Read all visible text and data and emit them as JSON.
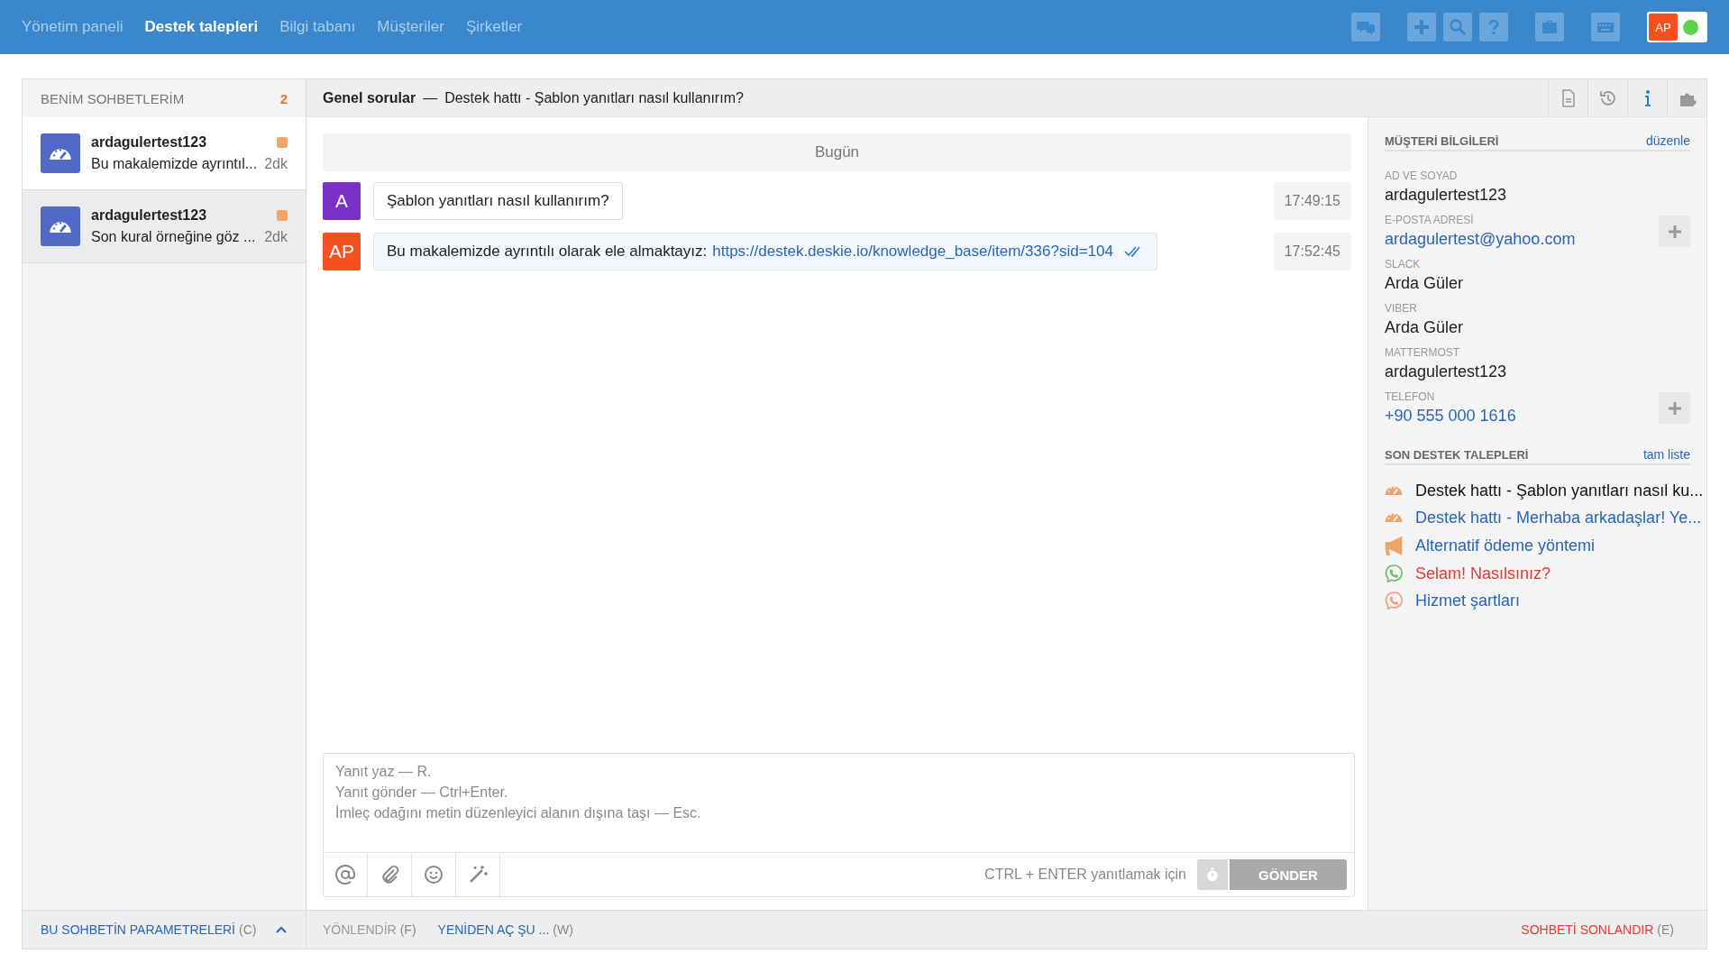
{
  "nav": {
    "tabs": [
      {
        "label": "Yönetim paneli",
        "selected": false
      },
      {
        "label": "Destek talepleri",
        "selected": true
      },
      {
        "label": "Bilgi tabanı",
        "selected": false
      },
      {
        "label": "Müşteriler",
        "selected": false
      },
      {
        "label": "Şirketler",
        "selected": false
      }
    ],
    "user": {
      "initials": "AP",
      "online": true
    }
  },
  "chat_list": {
    "title": "BENİM SOHBETLERİM",
    "count": "2",
    "items": [
      {
        "name": "ardagulertest123",
        "preview": "Bu makalemizde ayrıntıl...",
        "time": "2dk",
        "unread": true,
        "selected": true
      },
      {
        "name": "ardagulertest123",
        "preview": "Son kural örneğine göz ...",
        "time": "2dk",
        "unread": true,
        "selected": false
      }
    ]
  },
  "conversation": {
    "category": "Genel sorular",
    "separator": "—",
    "subject": "Destek hattı - Şablon yanıtları nasıl kullanırım?",
    "day": "Bugün",
    "messages": [
      {
        "kind": "incoming",
        "avatar": "A",
        "color": "#7b31c5",
        "text": "Şablon yanıtları nasıl kullanırım?",
        "time": "17:49:15",
        "read": false
      },
      {
        "kind": "outgoing",
        "avatar": "AP",
        "color": "#f4511e",
        "text": "Bu makalemizde ayrıntılı olarak ele almaktayız:",
        "link": "https://destek.deskie.io/knowledge_base/item/336?sid=104",
        "time": "17:52:45",
        "read": true
      }
    ],
    "composer": {
      "placeholder": "Yanıt yaz — R.\nYanıt gönder — Ctrl+Enter.\nİmleç odağını metin düzenleyici alanın dışına taşı — Esc.",
      "hint": "CTRL + ENTER yanıtlamak için",
      "send": "GÖNDER",
      "send_disabled": true
    }
  },
  "customer": {
    "title": "MÜŞTERİ BİLGİLERİ",
    "edit": "düzenle",
    "fields": [
      {
        "label": "AD VE SOYAD",
        "value": "ardagulertest123",
        "link": false,
        "addable": false
      },
      {
        "label": "E-POSTA ADRESİ",
        "value": "ardagulertest@yahoo.com",
        "link": true,
        "addable": true
      },
      {
        "label": "SLACK",
        "value": "Arda Güler",
        "link": false,
        "addable": false
      },
      {
        "label": "VIBER",
        "value": "Arda Güler",
        "link": false,
        "addable": false
      },
      {
        "label": "MATTERMOST",
        "value": "ardagulertest123",
        "link": false,
        "addable": false
      },
      {
        "label": "TELEFON",
        "value": "+90 555 000 1616",
        "link": true,
        "addable": true
      }
    ],
    "recent_title": "SON DESTEK TALEPLERİ",
    "recent_link": "tam liste",
    "recent": [
      {
        "kind": "gauge",
        "color": "#eda36a",
        "title": "Destek hattı - Şablon yanıtları nasıl ku...",
        "current": true,
        "alert": false
      },
      {
        "kind": "gauge",
        "color": "#eda36a",
        "title": "Destek hattı - Merhaba arkadaşlar! Ye...",
        "current": false,
        "alert": false
      },
      {
        "kind": "megaphone",
        "color": "#eda36a",
        "title": "Alternatif ödeme yöntemi",
        "current": false,
        "alert": false
      },
      {
        "kind": "viber",
        "color": "#6cbf6c",
        "title": "Selam! Nasılsınız?",
        "current": false,
        "alert": true
      },
      {
        "kind": "viber",
        "color": "#f0a080",
        "title": "Hizmet şartları",
        "current": false,
        "alert": false
      }
    ]
  },
  "footer": [
    {
      "label": "BU SOHBETİN PARAMETRELERİ",
      "key": "(C)",
      "kind": "link",
      "expander": true
    },
    {
      "label": "YÖNLENDİR",
      "key": "(F)",
      "kind": "disabled",
      "expander": false
    },
    {
      "label": "YENİDEN AÇ ŞU ...",
      "key": "(W)",
      "kind": "link",
      "expander": false
    },
    {
      "label": "SOHBETİ SONLANDIR",
      "key": "(E)",
      "kind": "danger",
      "expander": false
    }
  ]
}
